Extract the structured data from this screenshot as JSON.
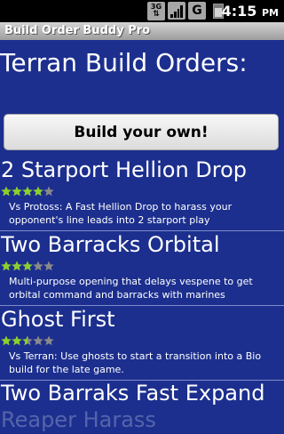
{
  "status_bar": {
    "network_label": "3G",
    "time": "4:15",
    "time_suffix": "PM",
    "icons": [
      "3g-icon",
      "signal-icon",
      "g-app-icon",
      "battery-icon"
    ]
  },
  "app": {
    "title": "Build Order Buddy Pro"
  },
  "heading": "Terran Build Orders:",
  "build_button_label": "Build your own!",
  "colors": {
    "background": "#1c2f8e",
    "star_filled": "#8bd12b",
    "star_empty": "#8a8a8a"
  },
  "builds": [
    {
      "title": "2 Starport Hellion Drop",
      "rating": 4,
      "rating_max": 5,
      "description": "Vs Protoss: A Fast Hellion Drop to harass your opponent's line leads into 2 starport play"
    },
    {
      "title": "Two Barracks Orbital",
      "rating": 3,
      "rating_max": 5,
      "description": "Multi-purpose opening that delays vespene to get orbital command and barracks with marines"
    },
    {
      "title": "Ghost First",
      "rating": 2.5,
      "rating_max": 5,
      "description": "Vs Terran: Use ghosts to start a transition into a Bio build for the late game."
    },
    {
      "title": "Two Barraks Fast Expand"
    },
    {
      "title": "Reaper Harass"
    }
  ]
}
